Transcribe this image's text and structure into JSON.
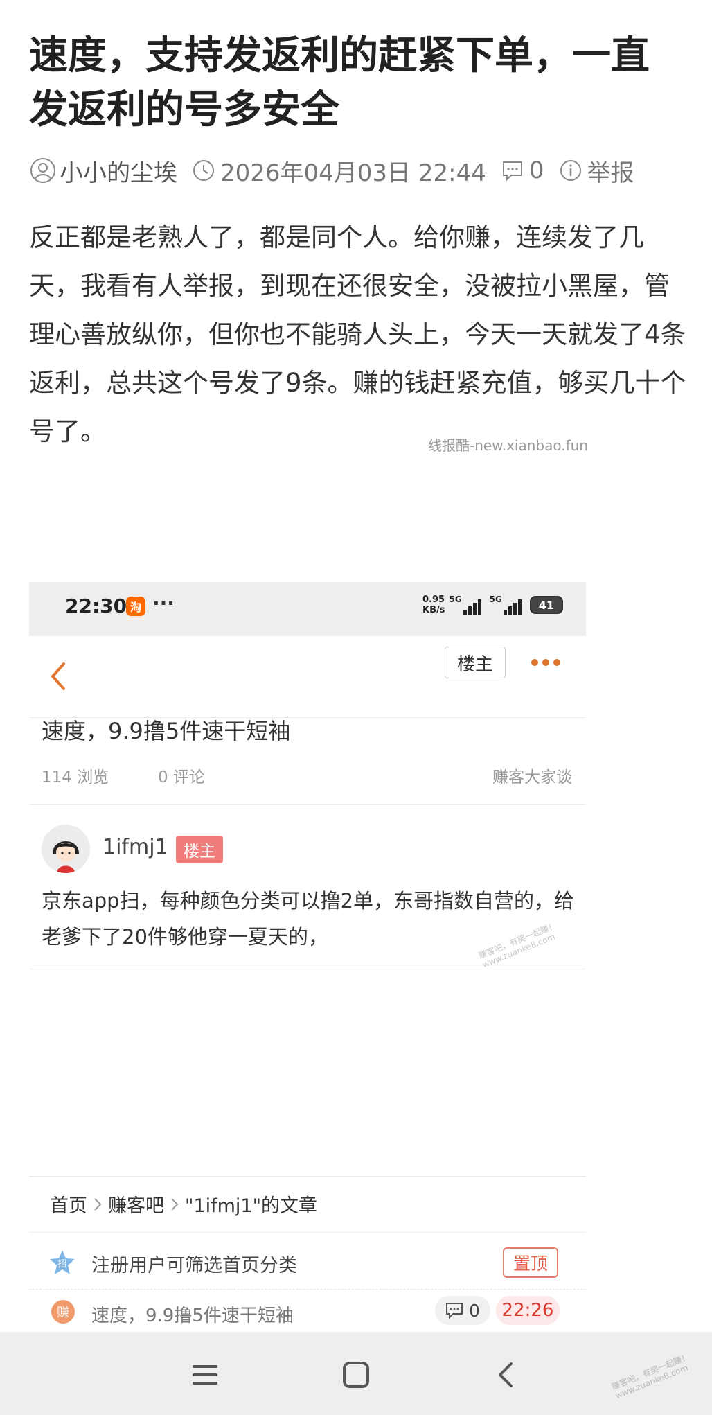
{
  "article": {
    "title": "速度，支持发返利的赶紧下单，一直发返利的号多安全",
    "author": "小小的尘埃",
    "datetime": "2026年04月03日 22:44",
    "comment_count": "0",
    "report_label": "举报",
    "body": "反正都是老熟人了，都是同个人。给你赚，连续发了几天，我看有人举报，到现在还很安全，没被拉小黑屋，管理心善放纵你，但你也不能骑人头上，今天一天就发了4条返利，总共这个号发了9条。赚的钱赶紧充值，够买几十个号了。",
    "watermark": "线报酷-new.xianbao.fun"
  },
  "screenshot": {
    "status_bar": {
      "time": "22:30",
      "app_icon_text": "淘",
      "dots": "···",
      "speed": "0.95",
      "speed_unit": "KB/s",
      "signal1": "5G",
      "signal2": "5G",
      "battery": "41"
    },
    "nav": {
      "owner_tag": "楼主"
    },
    "post": {
      "title": "速度，9.9撸5件速干短袖",
      "views": "114 浏览",
      "comments": "0 评论",
      "board": "赚客大家谈"
    },
    "reply": {
      "username": "1ifmj1",
      "badge": "楼主",
      "text": "京东app扫，每种颜色分类可以撸2单，东哥指数自营的，给老爹下了20件够他穿一夏天的，"
    },
    "watermark_line1": "赚客吧，有奖一起赚！",
    "watermark_line2": "www.zuanke8.com",
    "breadcrumb": [
      "首页",
      "赚客吧",
      "\"1ifmj1\"的文章"
    ],
    "list": [
      {
        "icon": "招",
        "text": "注册用户可筛选首页分类",
        "action": "置顶"
      },
      {
        "icon": "赚",
        "text": "速度，9.9撸5件速干短袖",
        "comments": "0",
        "time": "22:26"
      }
    ]
  },
  "watermark_corner_line1": "赚客吧，有奖一起赚！",
  "watermark_corner_line2": "www.zuanke8.com",
  "colors": {
    "accent_orange": "#e0762f",
    "badge_red": "#f07b7b",
    "time_red": "#d8372f"
  }
}
